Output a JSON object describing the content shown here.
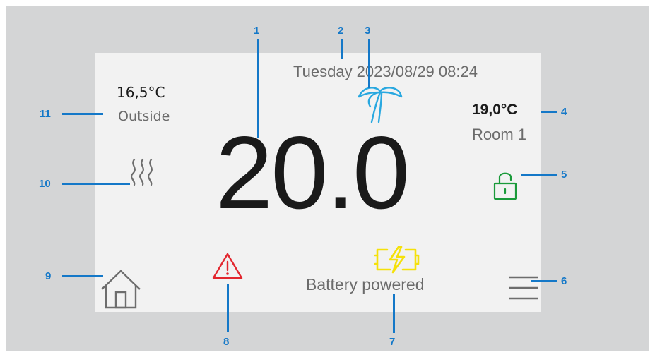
{
  "display": {
    "setpoint": "20.0",
    "datetime": "Tuesday 2023/08/29 08:24",
    "room_temp": "19,0°C",
    "room_name": "Room 1",
    "outside_temp": "16,5°C",
    "outside_label": "Outside",
    "power_status": "Battery powered"
  },
  "icons": {
    "holiday": "palm-tree-icon",
    "lock": "unlocked-padlock-icon",
    "menu": "hamburger-menu-icon",
    "battery": "battery-charging-icon",
    "warning": "warning-triangle-icon",
    "home": "home-icon",
    "heating": "heating-waves-icon"
  },
  "callouts": [
    "1",
    "2",
    "3",
    "4",
    "5",
    "6",
    "7",
    "8",
    "9",
    "10",
    "11"
  ],
  "colors": {
    "callout": "#1478c8",
    "holiday_icon": "#29a8e0",
    "lock_icon": "#1a9a3a",
    "battery_icon": "#f5e10a",
    "warning_icon": "#e2262e",
    "icon_gray": "#6d6d6d",
    "text_dark": "#1a1a1a",
    "text_gray": "#6b6b6b"
  }
}
